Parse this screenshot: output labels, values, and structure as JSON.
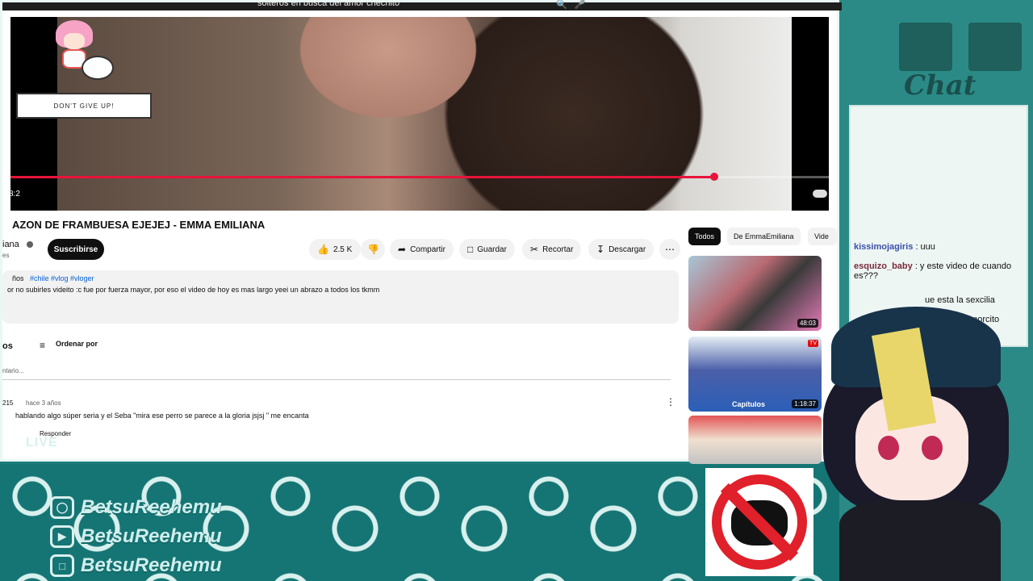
{
  "browser": {
    "search_query": "solteros en busca del amor chechito",
    "search_icon": "search-icon",
    "mic_icon": "mic-icon"
  },
  "player": {
    "time_left": "8:2",
    "progress_fraction": 0.86,
    "progress_color": "#e8143a",
    "sprite_speech": "DON'T GIVE UP!"
  },
  "video": {
    "title": "AZON DE FRAMBUESA EJEJEJ - EMMA EMILIANA",
    "channel_name": "iana",
    "channel_sub": "es",
    "subscribe_label": "Suscribirse",
    "actions": {
      "like_count": "2.5 K",
      "share": "Compartir",
      "save": "Guardar",
      "clip": "Recortar",
      "download": "Descargar"
    }
  },
  "description": {
    "meta": "ños",
    "tags": "#chile #vlog #vloger",
    "text": "or no subirles videito :c fue por fuerza mayor, por eso el video de hoy es mas largo yeei un abrazo a todos los tkmm"
  },
  "comments": {
    "header": "os",
    "sort_label": "Ordenar por",
    "input_placeholder": "ntario...",
    "items": [
      {
        "user": "215",
        "time": "hace 3 años",
        "text": "hablando algo súper seria y el Seba \"mira ese perro se parece a la gloria jsjsj \" me encanta",
        "reply": "Responder"
      }
    ]
  },
  "related": {
    "chips": [
      "Todos",
      "De EmmaEmiliana",
      "Vide"
    ],
    "videos": [
      {
        "duration": "48:03",
        "caption": ""
      },
      {
        "duration": "1:18:37",
        "caption": "Capítulos",
        "badge": "TV"
      },
      {
        "duration": "",
        "caption": ""
      }
    ]
  },
  "overlay": {
    "live_label": "LIVE",
    "socials": [
      {
        "icon": "instagram-icon",
        "name": "BetsuReehemu"
      },
      {
        "icon": "youtube-icon",
        "name": "BetsuReehemu"
      },
      {
        "icon": "twitch-icon",
        "name": "BetsuReehemu"
      }
    ],
    "chat_title": "Chat",
    "chat_messages": [
      {
        "user": "kissimojagiris",
        "text": ": uuu",
        "color": "blue"
      },
      {
        "user": "esquizo_baby",
        "text": ": y este video de cuando es???",
        "color": "red"
      },
      {
        "user": "",
        "text": "ue esta la sexcilia",
        "color": "red"
      },
      {
        "user": "",
        "text": "amorcito",
        "color": "red"
      }
    ]
  }
}
